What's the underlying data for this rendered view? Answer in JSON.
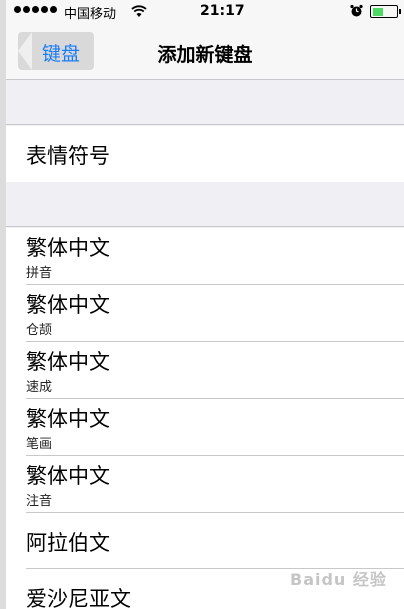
{
  "status_bar": {
    "carrier": "中国移动",
    "time": "21:17",
    "battery_level": 0.45
  },
  "nav": {
    "back_label": "键盘",
    "title": "添加新键盘"
  },
  "section1": {
    "items": [
      {
        "label": "表情符号"
      }
    ]
  },
  "section2": {
    "items": [
      {
        "label": "繁体中文",
        "sub": "拼音"
      },
      {
        "label": "繁体中文",
        "sub": "仓颉"
      },
      {
        "label": "繁体中文",
        "sub": "速成"
      },
      {
        "label": "繁体中文",
        "sub": "笔画"
      },
      {
        "label": "繁体中文",
        "sub": "注音"
      },
      {
        "label": "阿拉伯文"
      },
      {
        "label": "爱沙尼亚文"
      }
    ]
  },
  "watermark": "Baidu 经验",
  "colors": {
    "accent": "#1a7cf5",
    "battery": "#4cd964",
    "group_bg": "#efeff4",
    "separator": "#c8c7cc"
  }
}
